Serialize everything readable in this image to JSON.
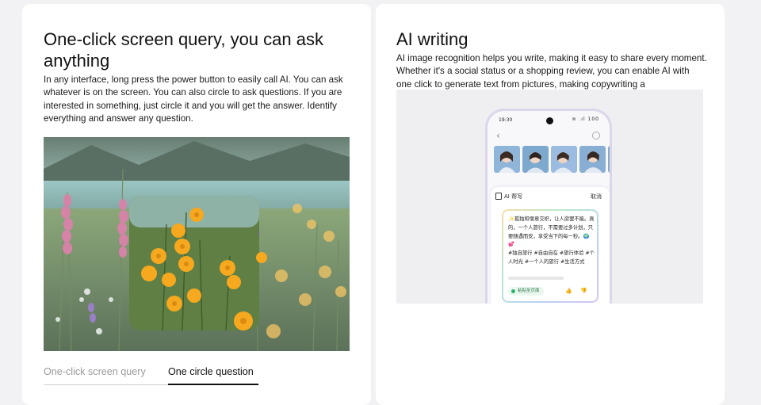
{
  "left_card": {
    "title": "One-click screen query, you can ask anything",
    "description": "In any interface, long press the power button to easily call AI. You can ask whatever is on the screen. You can also circle to ask questions. If you are interested in something, just circle it and you will get the answer. Identify everything and answer any question.",
    "tabs": [
      {
        "label": "One-click screen query",
        "active": false
      },
      {
        "label": "One circle question",
        "active": true
      }
    ]
  },
  "right_card": {
    "title": "AI writing",
    "description": "AI image recognition helps you write, making it easy to share every moment. Whether it's a social status or a shopping review, you can enable AI with one click to generate text from pictures, making copywriting a",
    "phone": {
      "time": "19:30",
      "status_icons": "≋ .ıl 100",
      "panel_title": "AI 帮写",
      "panel_cancel": "取消",
      "result_text": "✨孤独和惬意交织，让人欲罢不能。真的，一个人旅行，不需要过多计划，只要随遇而安，享受当下的每一秒。🌍💕\n#独自旅行 #自由自在 #旅行体验 #个人时光 #一个人的旅行 #生活方式",
      "paste_label": "粘贴至页面",
      "feedback_icons": "👍 👎"
    }
  },
  "colors": {
    "page_background": "#f2f2f4",
    "card_background": "#ffffff",
    "tab_active": "#111111",
    "tab_inactive": "#9a9a9a"
  }
}
